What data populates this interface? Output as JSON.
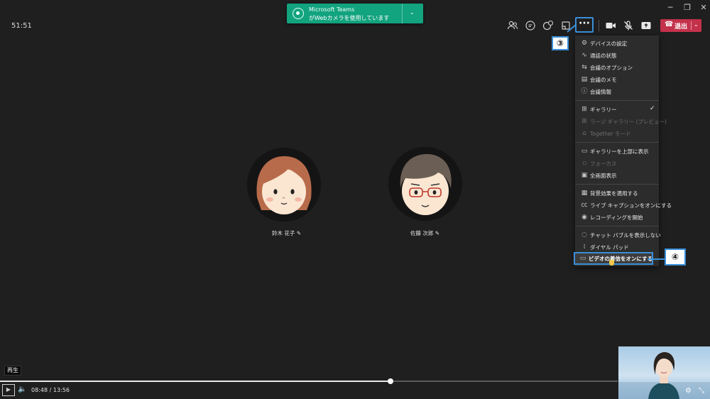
{
  "window": {
    "ghost_title": "",
    "controls": {
      "minimize": "─",
      "maximize": "❐",
      "close": "✕"
    }
  },
  "notification": {
    "app": "Microsoft Teams",
    "message": "がWebカメラを使用しています",
    "icon": "webcam-icon",
    "color": "#12a37f"
  },
  "toolbar": {
    "timer": "51:51",
    "icons": [
      "people-icon",
      "chat-icon",
      "reactions-icon",
      "share-tray-icon",
      "more-icon",
      "camera-icon",
      "mic-off-icon",
      "share-screen-icon"
    ],
    "more_label": "···",
    "leave_label": "退出",
    "leave_color": "#c4314b"
  },
  "callouts": {
    "step3": "③",
    "step4": "④"
  },
  "menu": {
    "groups": [
      [
        {
          "icon": "gear-icon",
          "label": "デバイスの設定",
          "disabled": false
        },
        {
          "icon": "pulse-icon",
          "label": "通話の状態",
          "disabled": false
        },
        {
          "icon": "sliders-icon",
          "label": "会議のオプション",
          "disabled": false
        },
        {
          "icon": "note-icon",
          "label": "会議のメモ",
          "disabled": false
        },
        {
          "icon": "info-icon",
          "label": "会議情報",
          "disabled": false
        }
      ],
      [
        {
          "icon": "gallery-icon",
          "label": "ギャラリー",
          "disabled": false,
          "checked": true
        },
        {
          "icon": "large-gallery-icon",
          "label": "ラージ ギャラリー (プレビュー)",
          "disabled": true
        },
        {
          "icon": "together-icon",
          "label": "Together モード",
          "disabled": true
        }
      ],
      [
        {
          "icon": "gallery-top-icon",
          "label": "ギャラリーを上部に表示",
          "disabled": false
        },
        {
          "icon": "focus-icon",
          "label": "フォーカス",
          "disabled": true
        },
        {
          "icon": "fullscreen-icon",
          "label": "全画面表示",
          "disabled": false
        }
      ],
      [
        {
          "icon": "background-effect-icon",
          "label": "背景効果を適用する",
          "disabled": false
        },
        {
          "icon": "caption-icon",
          "label": "ライブ キャプションをオンにする",
          "disabled": false
        },
        {
          "icon": "record-icon",
          "label": "レコーディングを開始",
          "disabled": false
        }
      ],
      [
        {
          "icon": "chat-bubble-icon",
          "label": "チャット バブルを表示しない",
          "disabled": false
        },
        {
          "icon": "dialpad-icon",
          "label": "ダイヤル パッド",
          "disabled": false
        }
      ]
    ],
    "highlighted": {
      "icon": "video-off-icon",
      "label": "ビデオの着信をオンにする"
    },
    "check_mark": "✓"
  },
  "participants": [
    {
      "name": "鈴木 花子",
      "muted": true,
      "avatar": "female-avatar"
    },
    {
      "name": "佐藤 次郎",
      "muted": true,
      "avatar": "male-avatar"
    }
  ],
  "mic_off_glyph": "✎",
  "playback": {
    "tooltip": "再生",
    "current": "08:48",
    "separator": "/",
    "total": "13:56",
    "progress_fraction": 0.632
  }
}
